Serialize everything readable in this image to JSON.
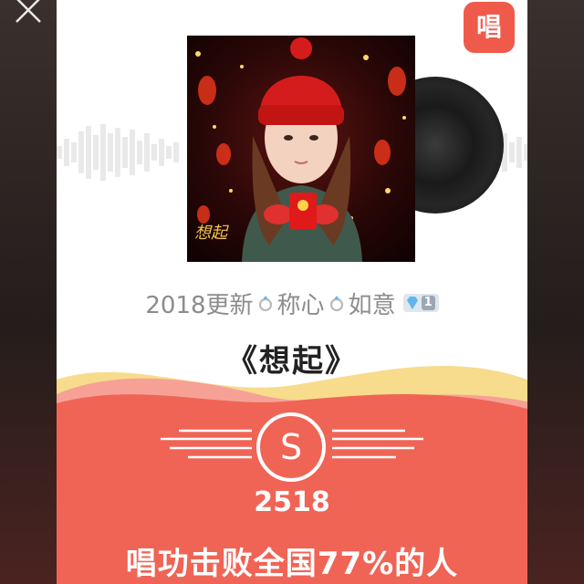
{
  "header": {
    "close_icon": "close-icon",
    "sing_badge_label": "唱"
  },
  "song": {
    "title_prefix": "2018更新",
    "title_mid": "称心",
    "title_suffix": "如意",
    "ring_icon": "ring-emoji-icon",
    "badge_level": "1",
    "song_title": "《想起》"
  },
  "result": {
    "grade": "S",
    "score": "2518",
    "rank_text": "唱功击败全国77%的人"
  },
  "colors": {
    "accent": "#f05a4a",
    "wave_yellow": "#f6dc8c",
    "wave_pink": "#f7a196"
  }
}
